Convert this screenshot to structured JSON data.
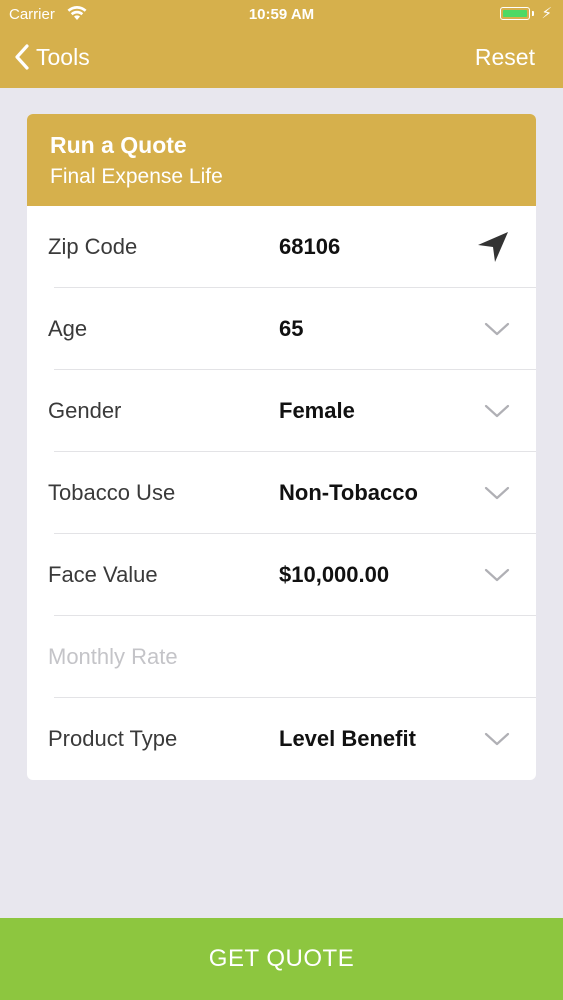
{
  "status_bar": {
    "carrier": "Carrier",
    "time": "10:59 AM",
    "battery_level": 1.0,
    "battery_color": "#4cd964"
  },
  "nav": {
    "back_label": "Tools",
    "back_icon": "chevron-left-icon",
    "reset_label": "Reset"
  },
  "card": {
    "title": "Run a Quote",
    "subtitle": "Final Expense Life",
    "rows": [
      {
        "label": "Zip Code",
        "value": "68106",
        "icon": "location-arrow-icon"
      },
      {
        "label": "Age",
        "value": "65",
        "icon": "chevron-down-icon"
      },
      {
        "label": "Gender",
        "value": "Female",
        "icon": "chevron-down-icon"
      },
      {
        "label": "Tobacco Use",
        "value": "Non-Tobacco",
        "icon": "chevron-down-icon"
      },
      {
        "label": "Face Value",
        "value": "$10,000.00",
        "icon": "chevron-down-icon"
      },
      {
        "label": "Monthly Rate",
        "value": "",
        "icon": ""
      },
      {
        "label": "Product Type",
        "value": "Level Benefit",
        "icon": "chevron-down-icon"
      }
    ]
  },
  "cta": {
    "label": "GET QUOTE"
  },
  "colors": {
    "accent": "#d6b04c",
    "cta": "#8dc63f",
    "background": "#e8e7ee"
  }
}
